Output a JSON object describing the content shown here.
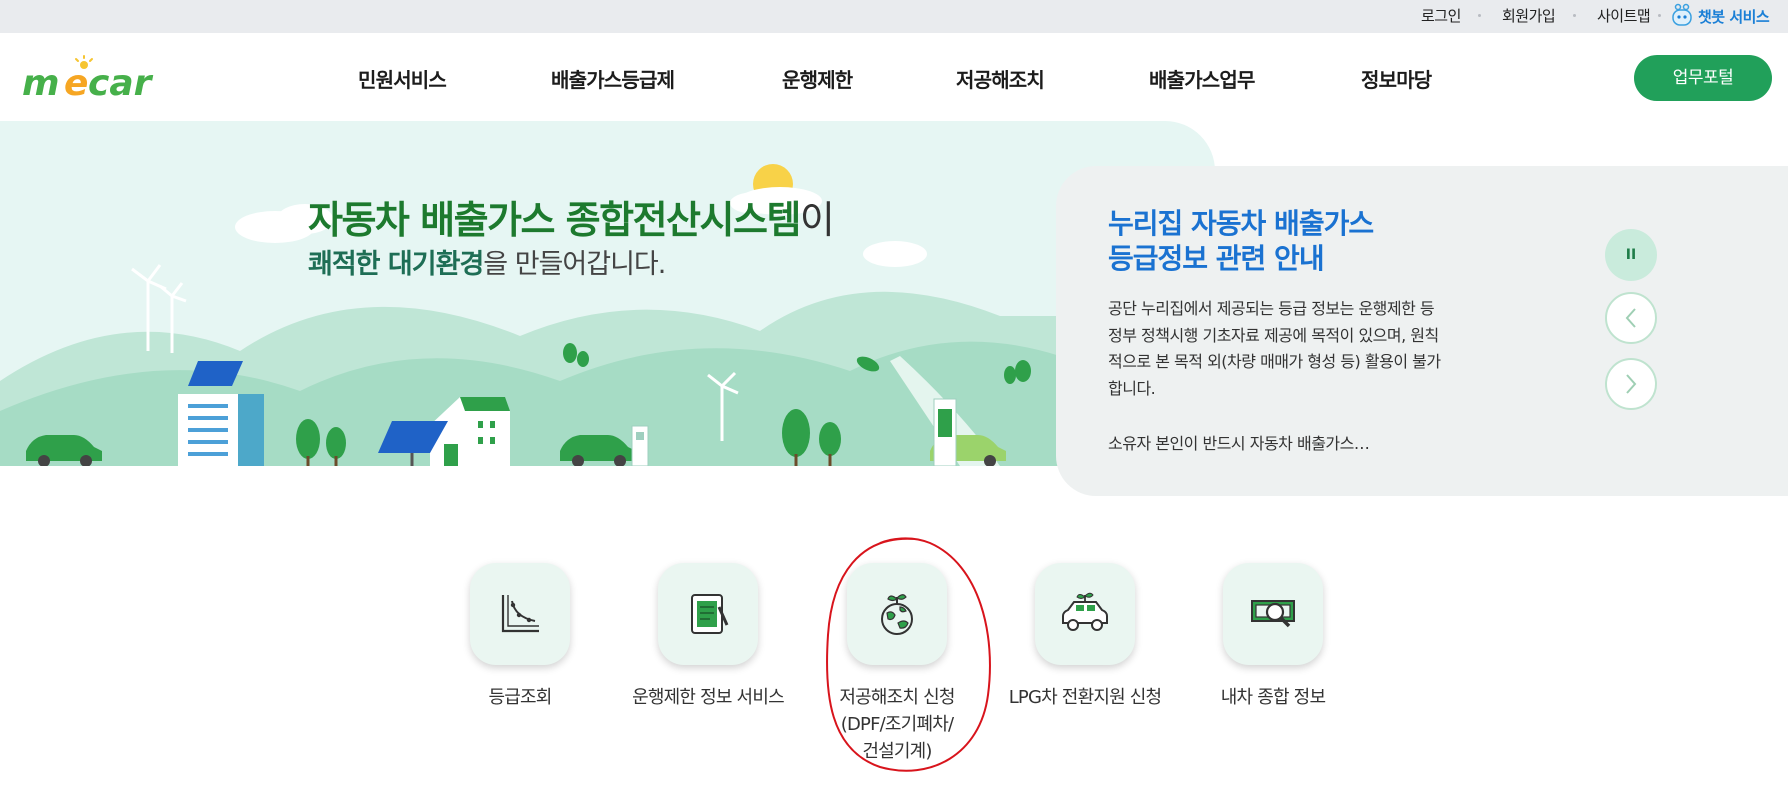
{
  "topbar": {
    "login": "로그인",
    "signup": "회원가입",
    "sitemap": "사이트맵",
    "chatbot": "챗봇 서비스"
  },
  "header": {
    "logo_text": "mecar",
    "nav": [
      "민원서비스",
      "배출가스등급제",
      "운행제한",
      "저공해조치",
      "배출가스업무",
      "정보마당"
    ],
    "portal_button": "업무포털"
  },
  "hero": {
    "title_bold": "자동차 배출가스 종합전산시스템",
    "title_suffix": "이",
    "sub_emphasis": "쾌적한 대기환경",
    "sub_rest": "을 만들어갑니다."
  },
  "notice": {
    "title_line1": "누리집 자동차 배출가스",
    "title_line2": "등급정보 관련 안내",
    "body": "공단 누리집에서 제공되는 등급 정보는 운행제한 등 정부 정책시행 기초자료 제공에 목적이 있으며, 원칙적으로 본 목적 외(차량 매매가 형성 등) 활용이 불가합니다.",
    "more": "소유자 본인이 반드시 자동차 배출가스…",
    "controls": {
      "pause": "II",
      "prev": "‹",
      "next": "›"
    }
  },
  "services": [
    {
      "label": "등급조회",
      "icon": "grade-chart-icon"
    },
    {
      "label": "운행제한 정보 서비스",
      "icon": "tablet-document-icon"
    },
    {
      "label": "저공해조치 신청\n(DPF/조기폐차/\n건설기계)",
      "icon": "earth-sprout-icon"
    },
    {
      "label": "LPG차 전환지원 신청",
      "icon": "eco-car-icon"
    },
    {
      "label": "내차 종합 정보",
      "icon": "search-money-icon"
    }
  ],
  "colors": {
    "brand_green": "#21a05a",
    "title_green": "#1d7a2e",
    "notice_blue": "#1a72d1",
    "chatbot_blue": "#1a7fd6",
    "annotation_red": "#d8141c"
  }
}
